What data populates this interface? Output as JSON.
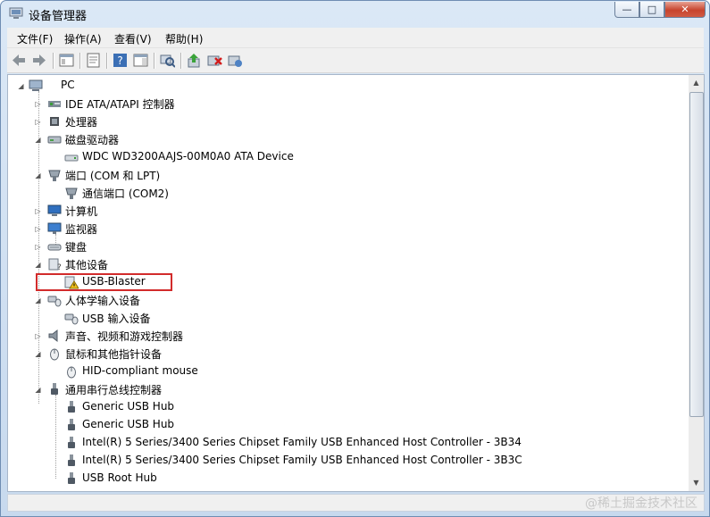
{
  "window": {
    "title": "设备管理器",
    "controls": [
      "—",
      "□",
      "✕"
    ]
  },
  "menu": [
    "文件(F)",
    "操作(A)",
    "查看(V)",
    "帮助(H)"
  ],
  "tree": [
    {
      "label": "PC",
      "icon": "computer-icon",
      "expander": "collapse-arrow"
    },
    {
      "label": "IDE ATA/ATAPI 控制器",
      "icon": "ide-controller-icon",
      "expander": "expand-arrow"
    },
    {
      "label": "处理器",
      "icon": "processor-icon",
      "expander": "expand-arrow"
    },
    {
      "label": "磁盘驱动器",
      "icon": "disk-drive-icon",
      "expander": "collapse-arrow"
    },
    {
      "label": "WDC WD3200AAJS-00M0A0 ATA Device",
      "icon": "hard-disk-icon",
      "expander": ""
    },
    {
      "label": "端口 (COM 和 LPT)",
      "icon": "port-icon",
      "expander": "collapse-arrow"
    },
    {
      "label": "通信端口 (COM2)",
      "icon": "port-icon",
      "expander": ""
    },
    {
      "label": "计算机",
      "icon": "computer-monitor-icon",
      "expander": "expand-arrow"
    },
    {
      "label": "监视器",
      "icon": "monitor-icon",
      "expander": "expand-arrow"
    },
    {
      "label": "键盘",
      "icon": "keyboard-icon",
      "expander": "expand-arrow"
    },
    {
      "label": "其他设备",
      "icon": "unknown-device-icon",
      "expander": "collapse-arrow"
    },
    {
      "label": "USB-Blaster",
      "icon": "warning-device-icon",
      "expander": ""
    },
    {
      "label": "人体学输入设备",
      "icon": "hid-icon",
      "expander": "collapse-arrow"
    },
    {
      "label": "USB 输入设备",
      "icon": "hid-icon",
      "expander": ""
    },
    {
      "label": "声音、视频和游戏控制器",
      "icon": "speaker-icon",
      "expander": "expand-arrow"
    },
    {
      "label": "鼠标和其他指针设备",
      "icon": "mouse-icon",
      "expander": "collapse-arrow"
    },
    {
      "label": "HID-compliant mouse",
      "icon": "mouse-icon",
      "expander": ""
    },
    {
      "label": "通用串行总线控制器",
      "icon": "usb-icon",
      "expander": "collapse-arrow"
    },
    {
      "label": "Generic USB Hub",
      "icon": "usb-icon",
      "expander": ""
    },
    {
      "label": "Generic USB Hub",
      "icon": "usb-icon",
      "expander": ""
    },
    {
      "label": "Intel(R) 5 Series/3400 Series Chipset Family USB Enhanced Host Controller - 3B34",
      "icon": "usb-icon",
      "expander": ""
    },
    {
      "label": "Intel(R) 5 Series/3400 Series Chipset Family USB Enhanced Host Controller - 3B3C",
      "icon": "usb-icon",
      "expander": ""
    },
    {
      "label": "USB Root Hub",
      "icon": "usb-icon",
      "expander": ""
    }
  ],
  "watermark": "@稀土掘金技术社区",
  "colors": {
    "highlight_border": "#d22b2b",
    "title_gradient_top": "#dbe8f6"
  }
}
